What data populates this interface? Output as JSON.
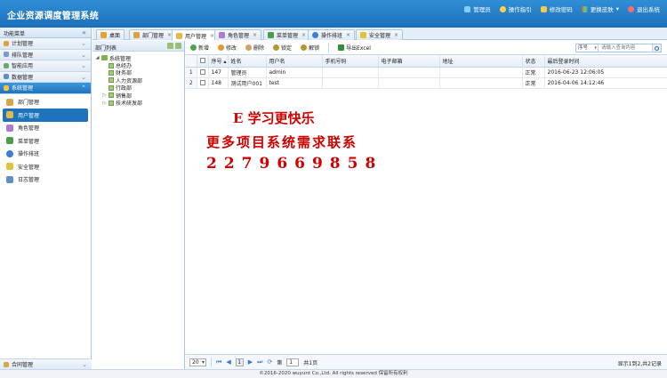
{
  "header": {
    "title": "企业资源调度管理系统",
    "actions": [
      {
        "label": "管理员",
        "icon": "user-icon",
        "color": "#7fd0ff"
      },
      {
        "label": "操作指引",
        "icon": "bulb-icon",
        "color": "#ffd34d"
      },
      {
        "label": "修改密码",
        "icon": "key-icon",
        "color": "#f2c94c"
      },
      {
        "label": "更换皮肤",
        "icon": "palette-icon",
        "color": "#6fcf6f"
      },
      {
        "label": "退出系统",
        "icon": "power-icon",
        "color": "#ff6b6b"
      }
    ]
  },
  "sidebar": {
    "title": "功能菜单",
    "groups": [
      {
        "label": "计划管理"
      },
      {
        "label": "排队管理"
      },
      {
        "label": "智能应用"
      },
      {
        "label": "数据管理"
      },
      {
        "label": "系统管理"
      }
    ],
    "items": [
      {
        "label": "部门管理",
        "icon": "department-icon",
        "color": "#d9a441"
      },
      {
        "label": "用户管理",
        "icon": "user-icon",
        "color": "#e6b84a"
      },
      {
        "label": "角色管理",
        "icon": "role-icon",
        "color": "#b07ad0"
      },
      {
        "label": "菜单管理",
        "icon": "menu-icon",
        "color": "#4a9d4a"
      },
      {
        "label": "操作排班",
        "icon": "globe-icon",
        "color": "#3b7fd1"
      },
      {
        "label": "安全管理",
        "icon": "shield-icon",
        "color": "#e2c23a"
      },
      {
        "label": "日志管理",
        "icon": "log-icon",
        "color": "#5d8fc9"
      }
    ],
    "bottom_group": "合同管理"
  },
  "tabs": [
    {
      "label": "桌面",
      "icon": "home-icon",
      "color": "#e8a13a",
      "closable": false
    },
    {
      "label": "部门管理",
      "icon": "department-icon",
      "color": "#d9a441",
      "closable": true
    },
    {
      "label": "用户管理",
      "icon": "user-icon",
      "color": "#e6b84a",
      "closable": true
    },
    {
      "label": "角色管理",
      "icon": "role-icon",
      "color": "#b07ad0",
      "closable": true
    },
    {
      "label": "菜单管理",
      "icon": "menu-icon",
      "color": "#4a9d4a",
      "closable": true
    },
    {
      "label": "操作排班",
      "icon": "globe-icon",
      "color": "#3b7fd1",
      "closable": true
    },
    {
      "label": "安全管理",
      "icon": "shield-icon",
      "color": "#e2c23a",
      "closable": true
    }
  ],
  "active_tab": "用户管理",
  "dept_panel": {
    "title": "部门列表",
    "root": "系统管理",
    "children": [
      {
        "label": "总经办",
        "expandable": false
      },
      {
        "label": "财务部",
        "expandable": false
      },
      {
        "label": "人力资源部",
        "expandable": false
      },
      {
        "label": "行政部",
        "expandable": false
      },
      {
        "label": "销售部",
        "expandable": true
      },
      {
        "label": "技术研发部",
        "expandable": true
      }
    ]
  },
  "toolbar": {
    "buttons": [
      {
        "label": "新增",
        "icon": "add-icon",
        "color": "#4aa54a"
      },
      {
        "label": "修改",
        "icon": "edit-icon",
        "color": "#e09a2f"
      },
      {
        "label": "删除",
        "icon": "delete-icon",
        "color": "#c9a36a"
      },
      {
        "label": "锁定",
        "icon": "lock-icon",
        "color": "#b8962e"
      },
      {
        "label": "解锁",
        "icon": "unlock-icon",
        "color": "#b8962e"
      }
    ],
    "export_label": "导出Excel",
    "search_field": "序号",
    "search_placeholder": "请输入查询内容"
  },
  "table": {
    "columns": [
      "",
      "",
      "序号",
      "姓名",
      "用户名",
      "手机号码",
      "电子邮箱",
      "地址",
      "状态",
      "最后登录时间"
    ],
    "rows": [
      {
        "rn": "1",
        "id": "147",
        "name": "管理员",
        "username": "admin",
        "phone": "",
        "email": "",
        "address": "",
        "status": "正常",
        "last_login": "2016-06-23 12:06:05"
      },
      {
        "rn": "2",
        "id": "148",
        "name": "测试用户001",
        "username": "test",
        "phone": "",
        "email": "",
        "address": "",
        "status": "正常",
        "last_login": "2016-04-06 14:12:46"
      }
    ]
  },
  "watermark": {
    "line1": "E 学习更快乐",
    "line2": "更多项目系统需求联系",
    "line3": "2279669858"
  },
  "pager": {
    "page_size": "20",
    "current_page": "1",
    "page_prefix": "第",
    "page_input": "1",
    "page_suffix": "共1页",
    "info": "显示1到2,共2记录"
  },
  "footer": "©2016-2020 wuyunt Co.,Ltd. All rights reserved 保留所有权利"
}
